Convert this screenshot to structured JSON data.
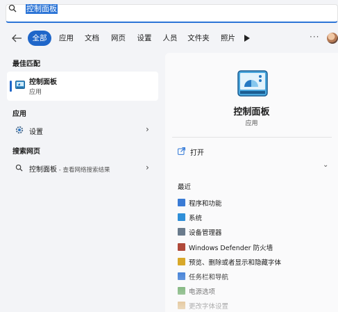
{
  "search": {
    "query": "控制面板"
  },
  "filters": [
    {
      "label": "全部",
      "active": true
    },
    {
      "label": "应用"
    },
    {
      "label": "文档"
    },
    {
      "label": "网页"
    },
    {
      "label": "设置"
    },
    {
      "label": "人员"
    },
    {
      "label": "文件夹"
    },
    {
      "label": "照片"
    }
  ],
  "more_label": "···",
  "left": {
    "best_match_heading": "最佳匹配",
    "best_match": {
      "title": "控制面板",
      "subtitle": "应用"
    },
    "apps_heading": "应用",
    "apps": [
      {
        "label": "设置"
      }
    ],
    "web_heading": "搜索网页",
    "web": {
      "label": "控制面板",
      "suffix": " - 查看网络搜索结果"
    }
  },
  "right": {
    "title": "控制面板",
    "subtitle": "应用",
    "open_label": "打开",
    "recent_heading": "最近",
    "recent": [
      {
        "label": "程序和功能",
        "icon": "programs-icon",
        "color": "#3a7bd5"
      },
      {
        "label": "系统",
        "icon": "system-icon",
        "color": "#2f8fd8"
      },
      {
        "label": "设备管理器",
        "icon": "device-manager-icon",
        "color": "#6a7b8c"
      },
      {
        "label": "Windows Defender 防火墙",
        "icon": "firewall-icon",
        "color": "#b0493a"
      },
      {
        "label": "预览、删除或者显示和隐藏字体",
        "icon": "fonts-icon",
        "color": "#d8a82a"
      },
      {
        "label": "任务栏和导航",
        "icon": "taskbar-icon",
        "color": "#3a7bd5"
      },
      {
        "label": "电源选项",
        "icon": "power-icon",
        "color": "#4f9a4a"
      },
      {
        "label": "更改字体设置",
        "icon": "font-settings-icon",
        "color": "#c98a2a"
      }
    ]
  },
  "colors": {
    "accent": "#1f66c9",
    "background": "#f3f4f7",
    "panel": "#fafafb"
  }
}
